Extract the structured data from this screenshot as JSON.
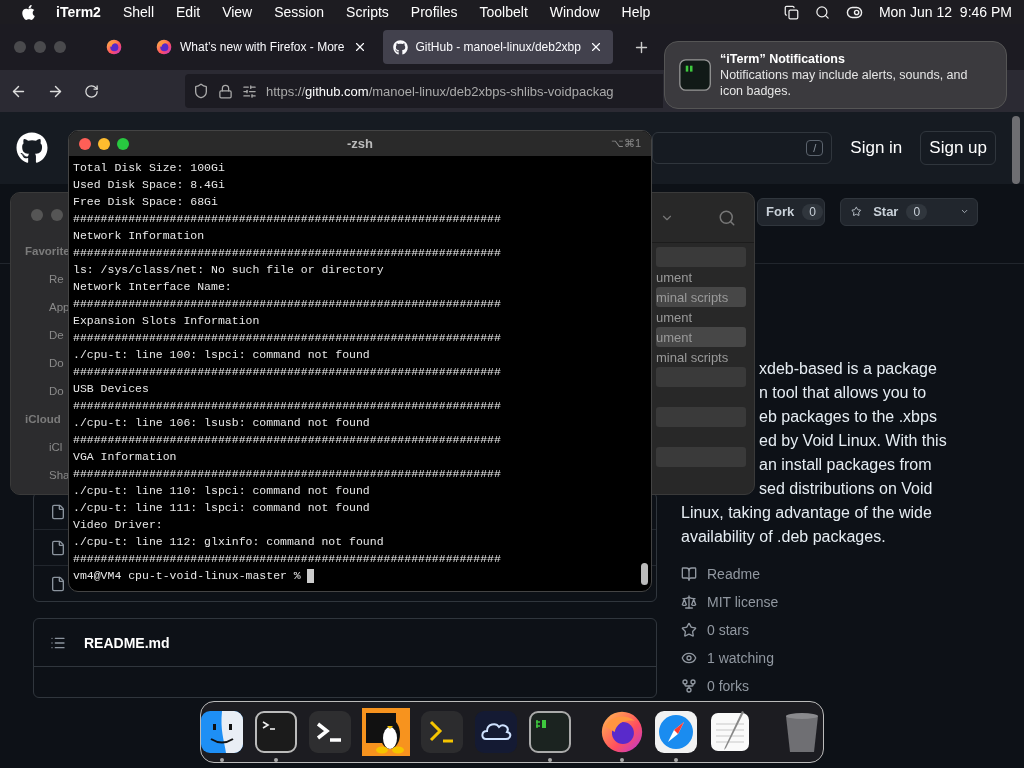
{
  "menubar": {
    "app": "iTerm2",
    "menus": [
      "Shell",
      "Edit",
      "View",
      "Session",
      "Scripts",
      "Profiles",
      "Toolbelt",
      "Window",
      "Help"
    ],
    "date": "Mon Jun 12",
    "time": "9:46 PM"
  },
  "browser": {
    "tabs": [
      {
        "title": "What’s new with Firefox - More",
        "selected": false
      },
      {
        "title": "GitHub - manoel-linux/deb2xbp",
        "selected": true
      }
    ],
    "url": {
      "scheme": "https://",
      "host": "github.com",
      "path": "/manoel-linux/deb2xbps-shlibs-voidpackag"
    }
  },
  "github": {
    "search_key": "/",
    "sign_in": "Sign in",
    "sign_up": "Sign up",
    "fork": {
      "label": "Fork",
      "count": "0"
    },
    "star": {
      "label": "Star",
      "count": "0"
    },
    "about": {
      "partial_lines": [
        "xdeb-based is a package",
        "n tool that allows you to",
        "eb packages to the .xbps",
        "ed by Void Linux. With this",
        "an install packages from",
        "sed distributions on Void"
      ],
      "lines": [
        "Linux, taking advantage of the wide",
        "availability of .deb packages."
      ]
    },
    "meta": [
      {
        "kind": "readme",
        "label": "Readme"
      },
      {
        "kind": "license",
        "label": "MIT license"
      },
      {
        "kind": "stars",
        "label": "0 stars"
      },
      {
        "kind": "watching",
        "label": "1 watching"
      },
      {
        "kind": "forks",
        "label": "0 forks"
      }
    ],
    "readme_title": "README.md"
  },
  "finder": {
    "sidebar": [
      {
        "kind": "header",
        "label": "Favorite"
      },
      {
        "kind": "item",
        "label": "Re"
      },
      {
        "kind": "item",
        "label": "App"
      },
      {
        "kind": "item",
        "label": "De"
      },
      {
        "kind": "item",
        "label": "Do"
      },
      {
        "kind": "item",
        "label": "Do"
      },
      {
        "kind": "header",
        "label": "iCloud"
      },
      {
        "kind": "item",
        "label": "iCl"
      },
      {
        "kind": "item",
        "label": "Sha"
      }
    ],
    "rows": [
      {
        "label": "ument",
        "shaded": false
      },
      {
        "label": "minal scripts",
        "shaded": true
      },
      {
        "label": "ument",
        "shaded": false
      },
      {
        "label": "ument",
        "shaded": true
      },
      {
        "label": "minal scripts",
        "shaded": false
      }
    ]
  },
  "terminal": {
    "title": "-zsh",
    "shortcut": "⌥⌘1",
    "lines": [
      "Total Disk Size: 100Gi",
      "Used Disk Space: 8.4Gi",
      "Free Disk Space: 68Gi",
      "##############################################################",
      "Network Information",
      "##############################################################",
      "ls: /sys/class/net: No such file or directory",
      "Network Interface Name:",
      "##############################################################",
      "Expansion Slots Information",
      "##############################################################",
      "./cpu-t: line 100: lspci: command not found",
      "##############################################################",
      "USB Devices",
      "##############################################################",
      "./cpu-t: line 106: lsusb: command not found",
      "##############################################################",
      "VGA Information",
      "##############################################################",
      "./cpu-t: line 110: lspci: command not found",
      "./cpu-t: line 111: lspci: command not found",
      "Video Driver:",
      "./cpu-t: line 112: glxinfo: command not found",
      "##############################################################"
    ],
    "prompt": "vm4@VM4 cpu-t-void-linux-master %"
  },
  "notification": {
    "title": "“iTerm” Notifications",
    "body": "Notifications may include alerts, sounds, and icon badges."
  },
  "dock": [
    {
      "kind": "finder",
      "running": true
    },
    {
      "kind": "terminal",
      "running": true
    },
    {
      "kind": "prompt",
      "running": false
    },
    {
      "kind": "penguin",
      "running": false
    },
    {
      "kind": "shell",
      "running": false
    },
    {
      "kind": "cloud",
      "running": false
    },
    {
      "kind": "iterm",
      "running": true
    },
    {
      "kind": "separator"
    },
    {
      "kind": "firefox",
      "running": true
    },
    {
      "kind": "safari",
      "running": true
    },
    {
      "kind": "textedit",
      "running": false
    },
    {
      "kind": "separator"
    },
    {
      "kind": "trash",
      "running": false
    }
  ]
}
